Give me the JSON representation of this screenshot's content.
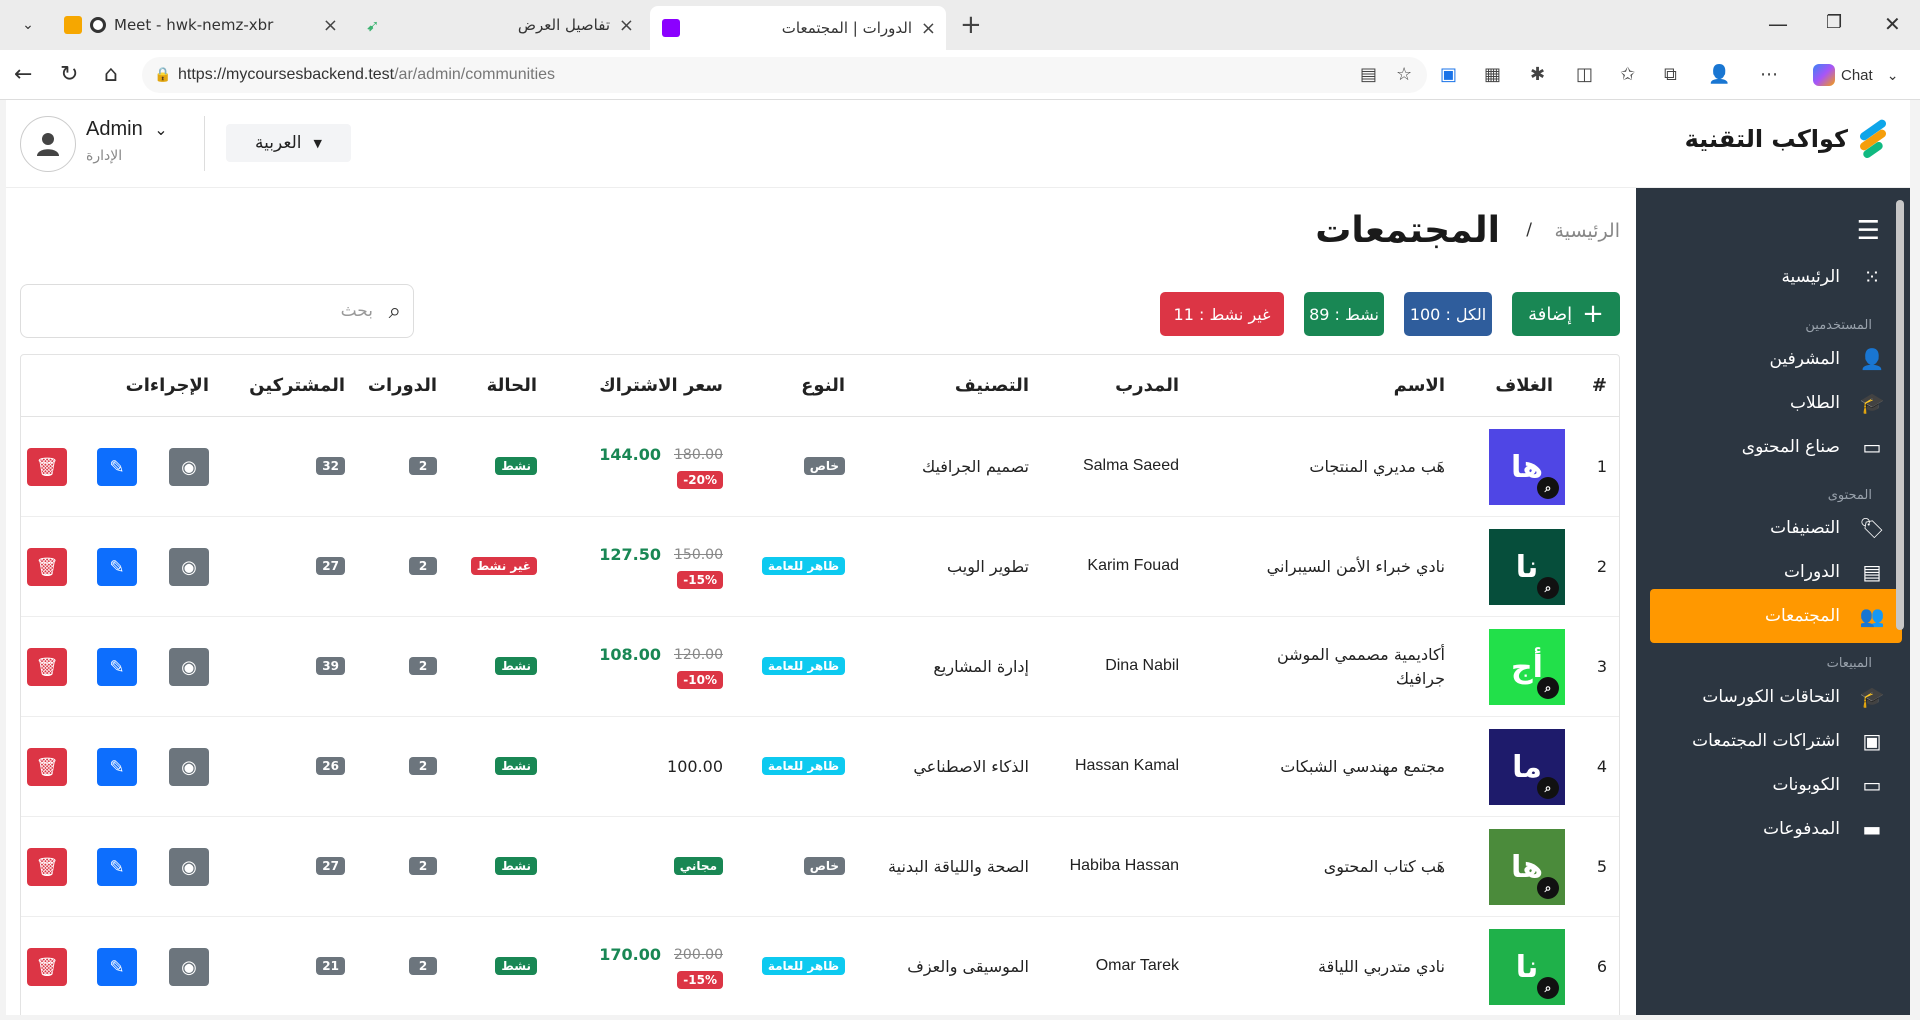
{
  "browser": {
    "tabs": [
      {
        "title": "Meet - hwk-nemz-xbr"
      },
      {
        "title": "تفاصيل العرض"
      },
      {
        "title": "الدورات | المجتمعات"
      }
    ],
    "url_host": "https://mycoursesbackend.test",
    "url_path": "/ar/admin/communities",
    "chat_label": "Chat"
  },
  "header": {
    "logo_text": "كواكب التقنية",
    "language": "العربية",
    "user_name": "Admin",
    "user_role": "الإدارة"
  },
  "sidebar": {
    "items": [
      {
        "label": "الرئيسية",
        "icon": "grid-icon"
      },
      {
        "group": "المستخدمين"
      },
      {
        "label": "المشرفين",
        "icon": "user-gear-icon"
      },
      {
        "label": "الطلاب",
        "icon": "graduate-icon"
      },
      {
        "label": "صناع المحتوى",
        "icon": "presenter-icon"
      },
      {
        "group": "المحتوى"
      },
      {
        "label": "التصنيفات",
        "icon": "tags-icon"
      },
      {
        "label": "الدورات",
        "icon": "book-icon"
      },
      {
        "label": "المجتمعات",
        "icon": "people-icon",
        "active": true
      },
      {
        "group": "المبيعات"
      },
      {
        "label": "التحاقات الكورسات",
        "icon": "cap-icon"
      },
      {
        "label": "اشتراكات المجتمعات",
        "icon": "id-card-icon"
      },
      {
        "label": "الكوبونات",
        "icon": "ticket-icon"
      },
      {
        "label": "المدفوعات",
        "icon": "card-icon"
      }
    ]
  },
  "page": {
    "breadcrumb_home": "الرئيسية",
    "breadcrumb_sep": "/",
    "title": "المجتمعات",
    "add_label": "إضافة",
    "stat_all": "الكل : 100",
    "stat_active": "نشط : 89",
    "stat_inactive": "غير نشط : 11",
    "search_placeholder": "بحث"
  },
  "table": {
    "headers": [
      "#",
      "الغلاف",
      "الاسم",
      "المدرب",
      "التصنيف",
      "النوع",
      "سعر الاشتراك",
      "الحالة",
      "الدورات",
      "المشتركين",
      "الإجراءات"
    ],
    "rows": [
      {
        "num": "1",
        "cover": "ها",
        "cover_color": "#4f46e5",
        "name": "هَب مديري المنتجات",
        "name2": "",
        "trainer": "Salma Saeed",
        "category": "تصميم الجرافيك",
        "type": "خاص",
        "type_kind": "private",
        "price_new": "144.00",
        "price_old": "180.00",
        "discount": "20%-",
        "price_plain": "",
        "free": "",
        "status": "نشط",
        "status_kind": "active",
        "courses": "2",
        "subscribers": "32"
      },
      {
        "num": "2",
        "cover": "نا",
        "cover_color": "#064e3b",
        "name": "نادي خبراء الأمن السيبراني",
        "name2": "",
        "trainer": "Karim Fouad",
        "category": "تطوير الويب",
        "type": "ظاهر للعامة",
        "type_kind": "public",
        "price_new": "127.50",
        "price_old": "150.00",
        "discount": "15%-",
        "price_plain": "",
        "free": "",
        "status": "غير نشط",
        "status_kind": "inactive",
        "courses": "2",
        "subscribers": "27"
      },
      {
        "num": "3",
        "cover": "أج",
        "cover_color": "#22e04a",
        "name": "أكاديمية مصممي الموشن",
        "name2": "جرافيك",
        "trainer": "Dina Nabil",
        "category": "إدارة المشاريع",
        "type": "ظاهر للعامة",
        "type_kind": "public",
        "price_new": "108.00",
        "price_old": "120.00",
        "discount": "10%-",
        "price_plain": "",
        "free": "",
        "status": "نشط",
        "status_kind": "active",
        "courses": "2",
        "subscribers": "39"
      },
      {
        "num": "4",
        "cover": "ما",
        "cover_color": "#1e1b6b",
        "name": "مجتمع مهندسي الشبكات",
        "name2": "",
        "trainer": "Hassan Kamal",
        "category": "الذكاء الاصطناعي",
        "type": "ظاهر للعامة",
        "type_kind": "public",
        "price_new": "",
        "price_old": "",
        "discount": "",
        "price_plain": "100.00",
        "free": "",
        "status": "نشط",
        "status_kind": "active",
        "courses": "2",
        "subscribers": "26"
      },
      {
        "num": "5",
        "cover": "ها",
        "cover_color": "#4b8b3b",
        "name": "هَب كتاب المحتوى",
        "name2": "",
        "trainer": "Habiba Hassan",
        "category": "الصحة واللياقة البدنية",
        "type": "خاص",
        "type_kind": "private",
        "price_new": "",
        "price_old": "",
        "discount": "",
        "price_plain": "",
        "free": "مجاني",
        "status": "نشط",
        "status_kind": "active",
        "courses": "2",
        "subscribers": "27"
      },
      {
        "num": "6",
        "cover": "نا",
        "cover_color": "#1fb14a",
        "name": "نادي متدربي اللياقة",
        "name2": "",
        "trainer": "Omar Tarek",
        "category": "الموسيقى والعزف",
        "type": "ظاهر للعامة",
        "type_kind": "public",
        "price_new": "170.00",
        "price_old": "200.00",
        "discount": "15%-",
        "price_plain": "",
        "free": "",
        "status": "نشط",
        "status_kind": "active",
        "courses": "2",
        "subscribers": "21"
      }
    ]
  },
  "colors": {
    "sidebar_bg": "#2c3641",
    "sidebar_active": "#ff9800",
    "success": "#198754",
    "primary": "#0d6efd",
    "danger": "#dc3545",
    "secondary": "#6c757d",
    "info": "#0dcaf0",
    "stat_all": "#2f5d9c"
  }
}
